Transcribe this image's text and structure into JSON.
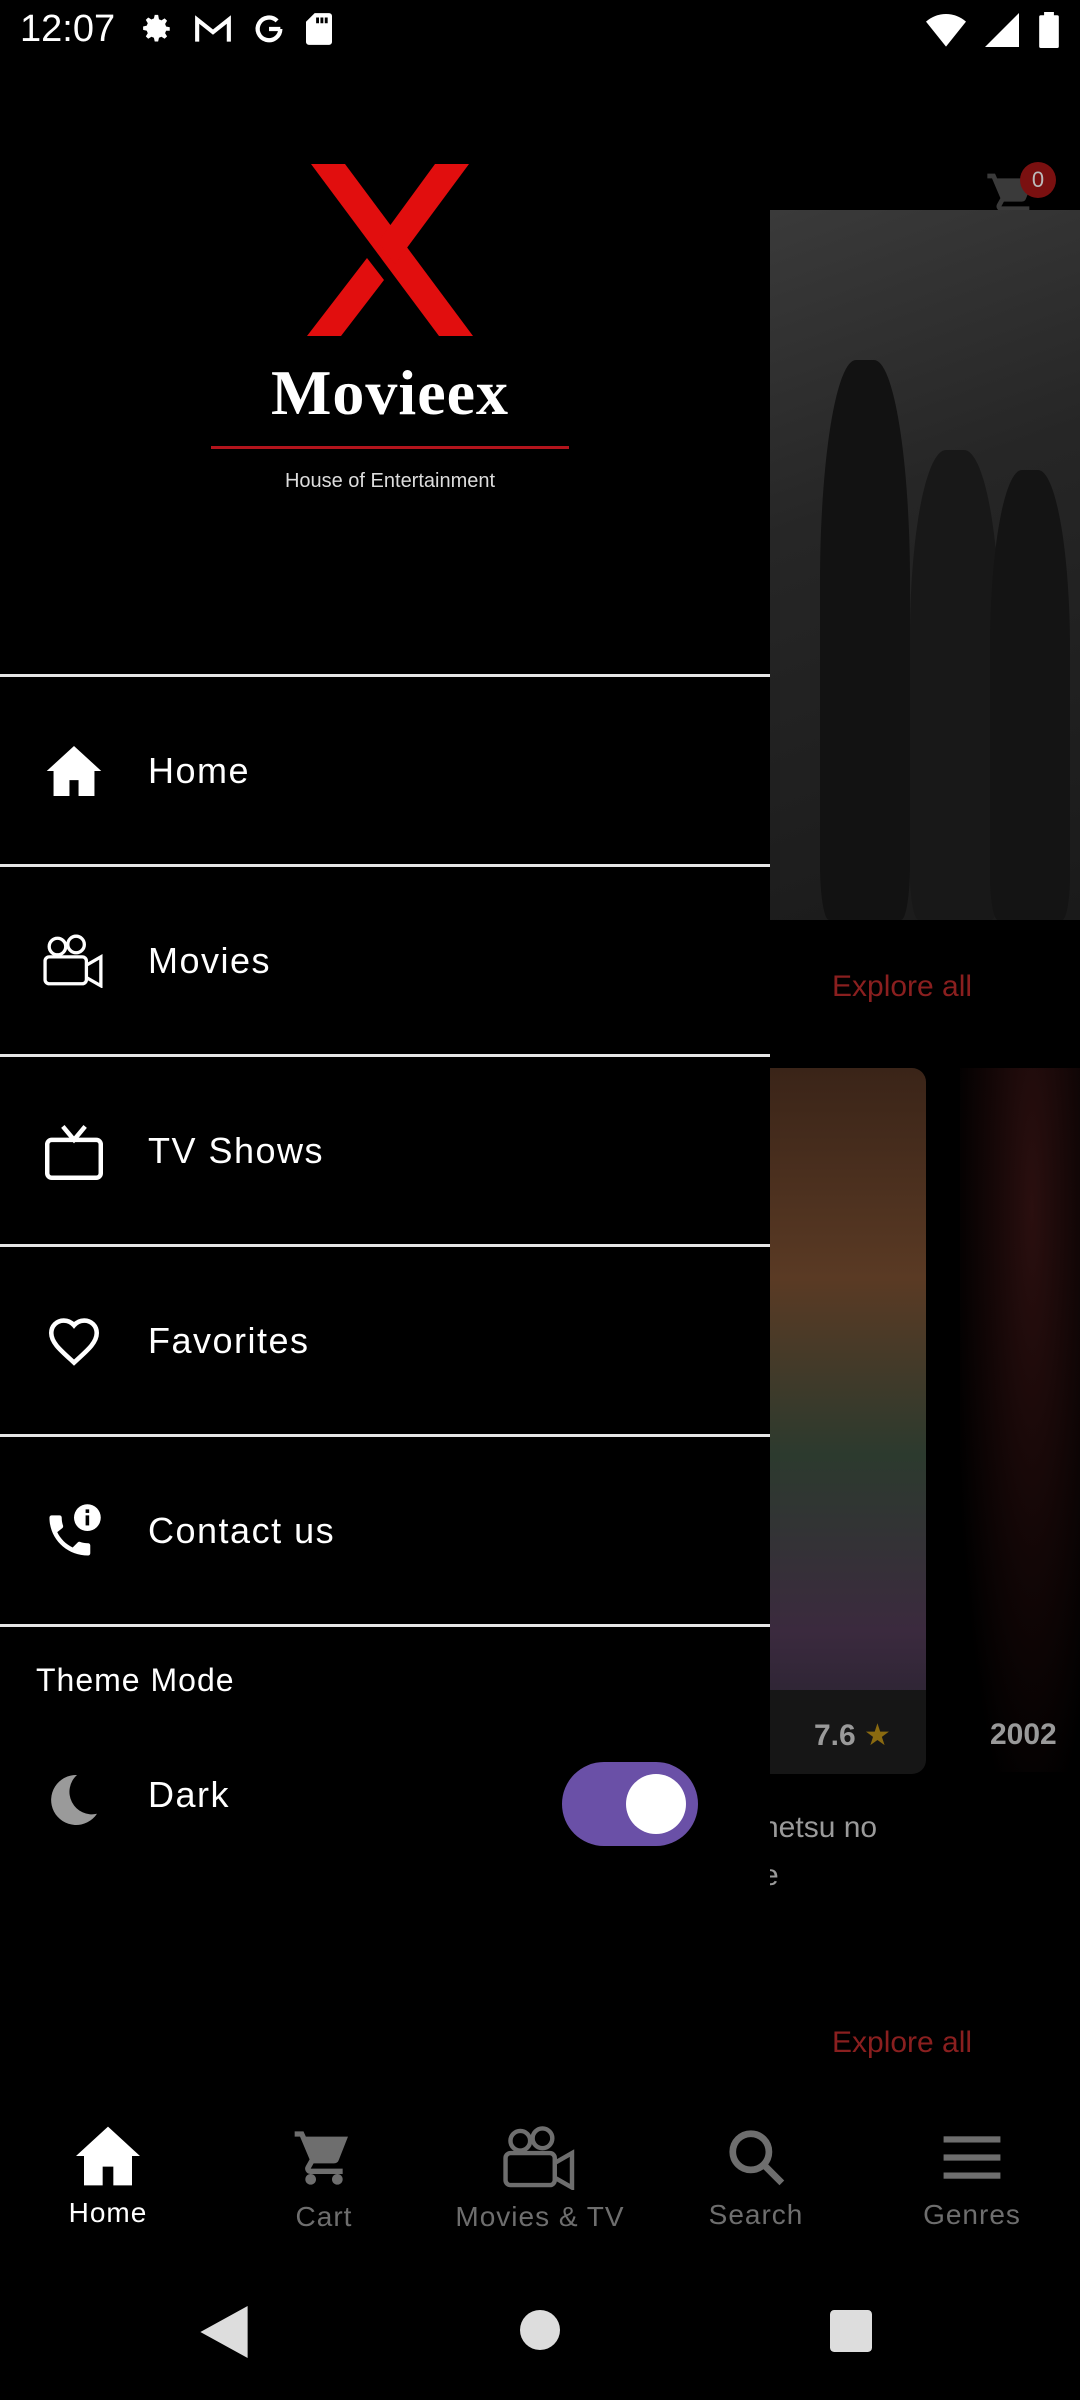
{
  "status_bar": {
    "time": "12:07",
    "left_icons": [
      "gear-icon",
      "gmail-icon",
      "google-icon",
      "sd-card-icon"
    ],
    "right_icons": [
      "wifi-icon",
      "signal-icon",
      "battery-icon"
    ]
  },
  "background": {
    "cart_badge": "0",
    "explore_all_1": "Explore all",
    "explore_all_2": "Explore all",
    "card_rating": "7.6",
    "card_year": "2002",
    "card_title_line1": "netsu no",
    "card_title_line2": "e"
  },
  "drawer": {
    "logo": {
      "wordmark": "Movieex",
      "tagline": "House of Entertainment",
      "brand_color": "#e10e0e"
    },
    "menu": [
      {
        "label": "Home",
        "icon": "home-icon"
      },
      {
        "label": "Movies",
        "icon": "video-camera-icon"
      },
      {
        "label": "TV Shows",
        "icon": "tv-icon"
      },
      {
        "label": "Favorites",
        "icon": "heart-icon"
      },
      {
        "label": "Contact us",
        "icon": "phone-info-icon"
      }
    ],
    "theme": {
      "title": "Theme Mode",
      "mode_label": "Dark",
      "icon": "moon-icon",
      "enabled": true,
      "toggle_color": "#6a50a7"
    }
  },
  "bottom_nav": {
    "items": [
      {
        "label": "Home",
        "icon": "home-icon",
        "active": true
      },
      {
        "label": "Cart",
        "icon": "cart-icon",
        "active": false
      },
      {
        "label": "Movies & TV",
        "icon": "video-camera-icon",
        "active": false
      },
      {
        "label": "Search",
        "icon": "search-icon",
        "active": false
      },
      {
        "label": "Genres",
        "icon": "menu-icon",
        "active": false
      }
    ]
  },
  "system_nav": {
    "buttons": [
      "back-icon",
      "home-circle-icon",
      "recents-icon"
    ]
  }
}
